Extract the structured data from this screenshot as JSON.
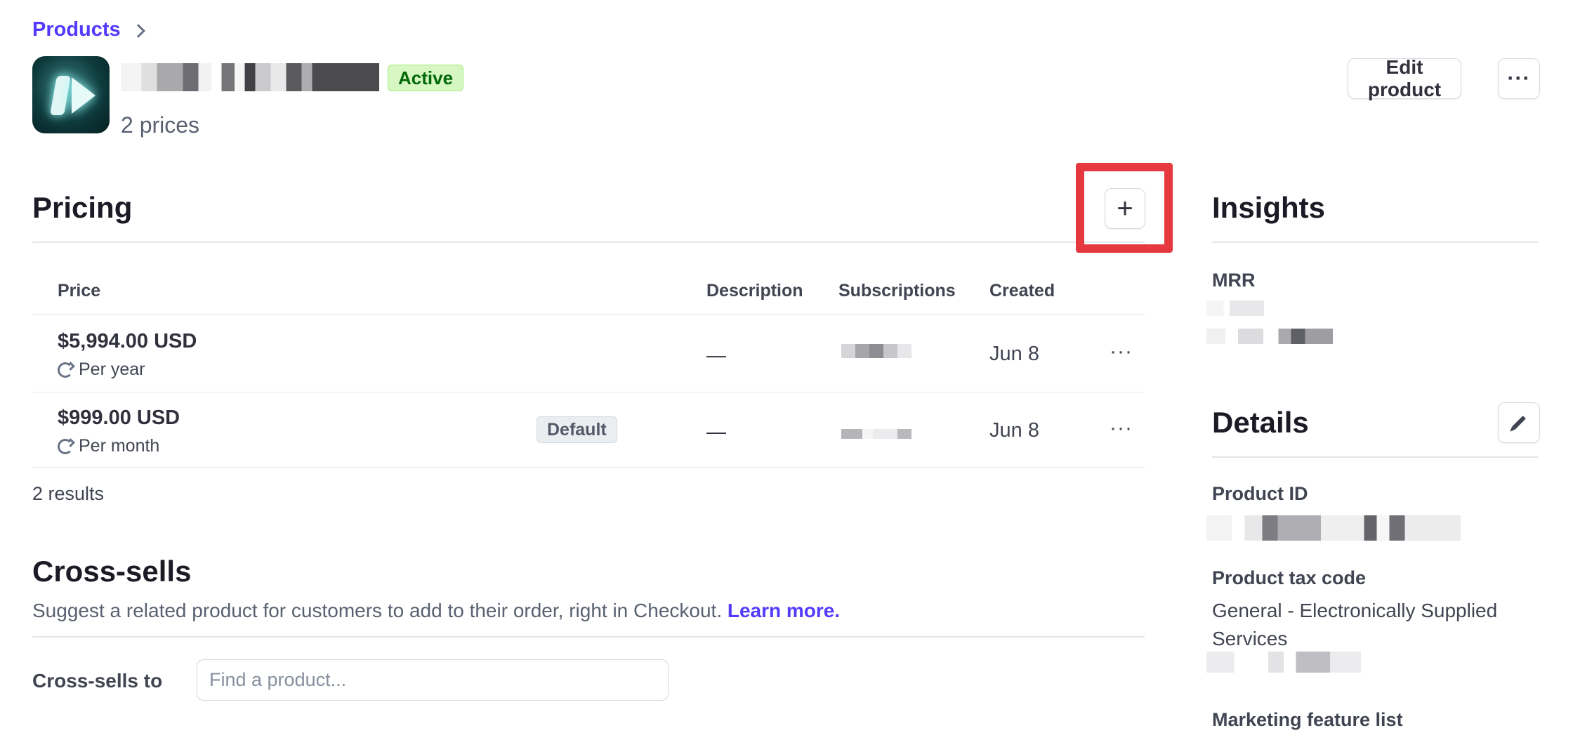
{
  "breadcrumb": {
    "products": "Products"
  },
  "product": {
    "status": "Active",
    "prices_count": "2 prices",
    "edit_label": "Edit product",
    "more_label": "···"
  },
  "pricing": {
    "title": "Pricing",
    "add_label": "+",
    "columns": [
      "Price",
      "Description",
      "Subscriptions",
      "Created"
    ],
    "rows": [
      {
        "amount": "$5,994.00 USD",
        "interval": "Per year",
        "badge": "",
        "description": "—",
        "created": "Jun 8",
        "more": "···"
      },
      {
        "amount": "$999.00 USD",
        "interval": "Per month",
        "badge": "Default",
        "description": "—",
        "created": "Jun 8",
        "more": "···"
      }
    ],
    "results": "2 results"
  },
  "cross_sells": {
    "title": "Cross-sells",
    "description": "Suggest a related product for customers to add to their order, right in Checkout.",
    "learn_more": "Learn more.",
    "label": "Cross-sells to",
    "placeholder": "Find a product..."
  },
  "insights": {
    "title": "Insights",
    "mrr_label": "MRR"
  },
  "details": {
    "title": "Details",
    "product_id_label": "Product ID",
    "tax_code_label": "Product tax code",
    "tax_code_value": "General - Electronically Supplied Services",
    "marketing_label": "Marketing feature list"
  },
  "colors": {
    "accent": "#533afd",
    "highlight": "#e5393f",
    "active_badge_bg": "#d7f7c2",
    "active_badge_text": "#006908"
  }
}
